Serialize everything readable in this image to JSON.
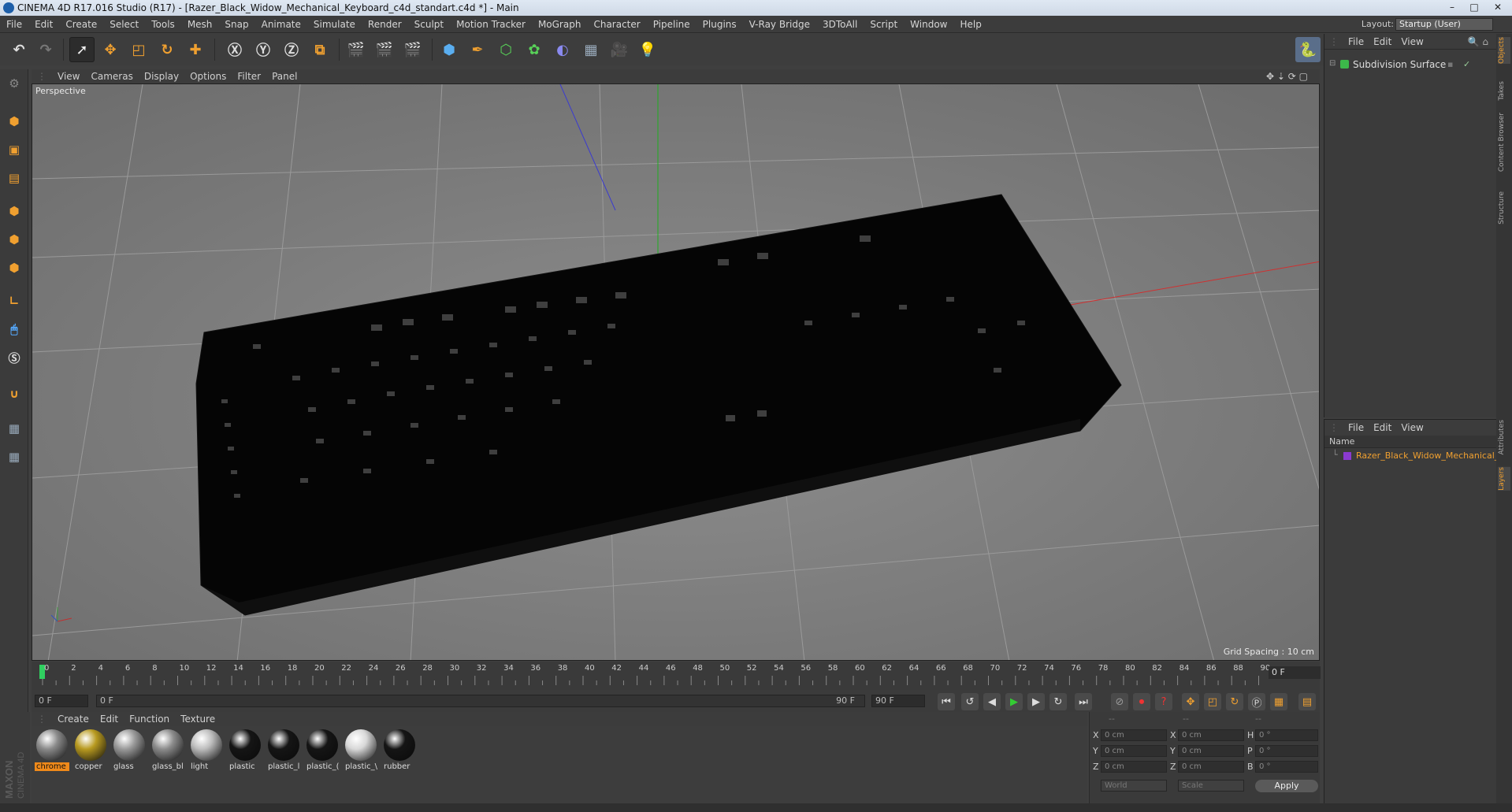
{
  "window": {
    "title": "CINEMA 4D R17.016 Studio (R17) - [Razer_Black_Widow_Mechanical_Keyboard_c4d_standart.c4d *] - Main",
    "minimize": "–",
    "maximize": "□",
    "close": "✕"
  },
  "menu": [
    "File",
    "Edit",
    "Create",
    "Select",
    "Tools",
    "Mesh",
    "Snap",
    "Animate",
    "Simulate",
    "Render",
    "Sculpt",
    "Motion Tracker",
    "MoGraph",
    "Character",
    "Pipeline",
    "Plugins",
    "V-Ray Bridge",
    "3DToAll",
    "Script",
    "Window",
    "Help"
  ],
  "layout": {
    "label": "Layout:",
    "value": "Startup (User)"
  },
  "viewport": {
    "menu": [
      "View",
      "Cameras",
      "Display",
      "Options",
      "Filter",
      "Panel"
    ],
    "label": "Perspective",
    "grid_spacing": "Grid Spacing : 10 cm"
  },
  "timeline": {
    "ticks": [
      "0",
      "2",
      "4",
      "6",
      "8",
      "10",
      "12",
      "14",
      "16",
      "18",
      "20",
      "22",
      "24",
      "26",
      "28",
      "30",
      "32",
      "34",
      "36",
      "38",
      "40",
      "42",
      "44",
      "46",
      "48",
      "50",
      "52",
      "54",
      "56",
      "58",
      "60",
      "62",
      "64",
      "66",
      "68",
      "70",
      "72",
      "74",
      "76",
      "78",
      "80",
      "82",
      "84",
      "86",
      "88",
      "90"
    ],
    "current_frame": "0 F"
  },
  "anim": {
    "start": "0 F",
    "range_start": "0 F",
    "range_end": "90 F",
    "end": "90 F"
  },
  "materials": {
    "menu": [
      "Create",
      "Edit",
      "Function",
      "Texture"
    ],
    "items": [
      {
        "label": "chrome",
        "color": "#8a8a8a"
      },
      {
        "label": "copper",
        "color": "#b89a20"
      },
      {
        "label": "glass",
        "color": "#9a9a9a"
      },
      {
        "label": "glass_bl",
        "color": "#8c8c8c"
      },
      {
        "label": "light",
        "color": "#bdbdbd"
      },
      {
        "label": "plastic",
        "color": "#151515"
      },
      {
        "label": "plastic_l",
        "color": "#151515"
      },
      {
        "label": "plastic_(",
        "color": "#151515"
      },
      {
        "label": "plastic_\\",
        "color": "#d8d8d8"
      },
      {
        "label": "rubber",
        "color": "#151515"
      }
    ]
  },
  "coords": {
    "header": [
      "--",
      "--",
      "--"
    ],
    "rows": [
      {
        "a": "X",
        "av": "0 cm",
        "b": "X",
        "bv": "0 cm",
        "c": "H",
        "cv": "0 °"
      },
      {
        "a": "Y",
        "av": "0 cm",
        "b": "Y",
        "bv": "0 cm",
        "c": "P",
        "cv": "0 °"
      },
      {
        "a": "Z",
        "av": "0 cm",
        "b": "Z",
        "bv": "0 cm",
        "c": "B",
        "cv": "0 °"
      }
    ],
    "world": "World",
    "scale": "Scale",
    "apply": "Apply"
  },
  "objects": {
    "menu": [
      "File",
      "Edit",
      "View"
    ],
    "item": "Subdivision Surface"
  },
  "layers": {
    "menu": [
      "File",
      "Edit",
      "View"
    ],
    "column": "Name",
    "item": "Razer_Black_Widow_Mechanical_I"
  },
  "right_tabs": [
    "Objects",
    "Takes",
    "Content Browser",
    "Structure",
    "Attributes",
    "Layers"
  ],
  "brand": "MAXON CINEMA 4D"
}
